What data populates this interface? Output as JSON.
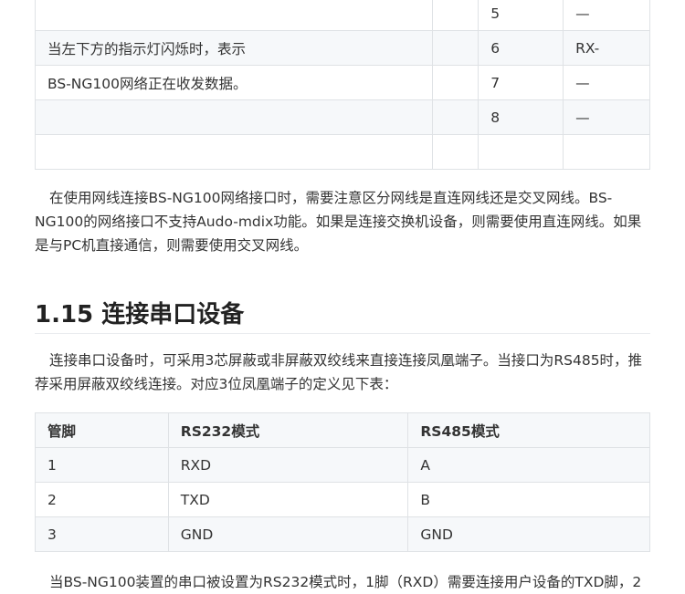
{
  "pin_table": {
    "rows": [
      {
        "desc": "",
        "pin": "5",
        "signal": "—"
      },
      {
        "desc": "当左下方的指示灯闪烁时，表示",
        "pin": "6",
        "signal": "RX-"
      },
      {
        "desc": "BS-NG100网络正在收发数据。",
        "pin": "7",
        "signal": "—"
      },
      {
        "desc": "",
        "pin": "8",
        "signal": "—"
      },
      {
        "desc": "",
        "pin": "",
        "signal": ""
      }
    ]
  },
  "paragraph_cable": "在使用网线连接BS-NG100网络接口时，需要注意区分网线是直连网线还是交叉网线。BS-NG100的网络接口不支持Audo-mdix功能。如果是连接交换机设备，则需要使用直连网线。如果是与PC机直接通信，则需要使用交叉网线。",
  "section": {
    "heading": "1.15 连接串口设备",
    "intro": "连接串口设备时，可采用3芯屏蔽或非屏蔽双绞线来直接连接凤凰端子。当接口为RS485时，推荐采用屏蔽双绞线连接。对应3位凤凰端子的定义见下表：",
    "serial_table": {
      "headers": [
        "管脚",
        "RS232模式",
        "RS485模式"
      ],
      "rows": [
        [
          "1",
          "RXD",
          "A"
        ],
        [
          "2",
          "TXD",
          "B"
        ],
        [
          "3",
          "GND",
          "GND"
        ]
      ]
    },
    "footer_text": "当BS-NG100装置的串口被设置为RS232模式时，1脚（RXD）需要连接用户设备的TXD脚，2"
  }
}
